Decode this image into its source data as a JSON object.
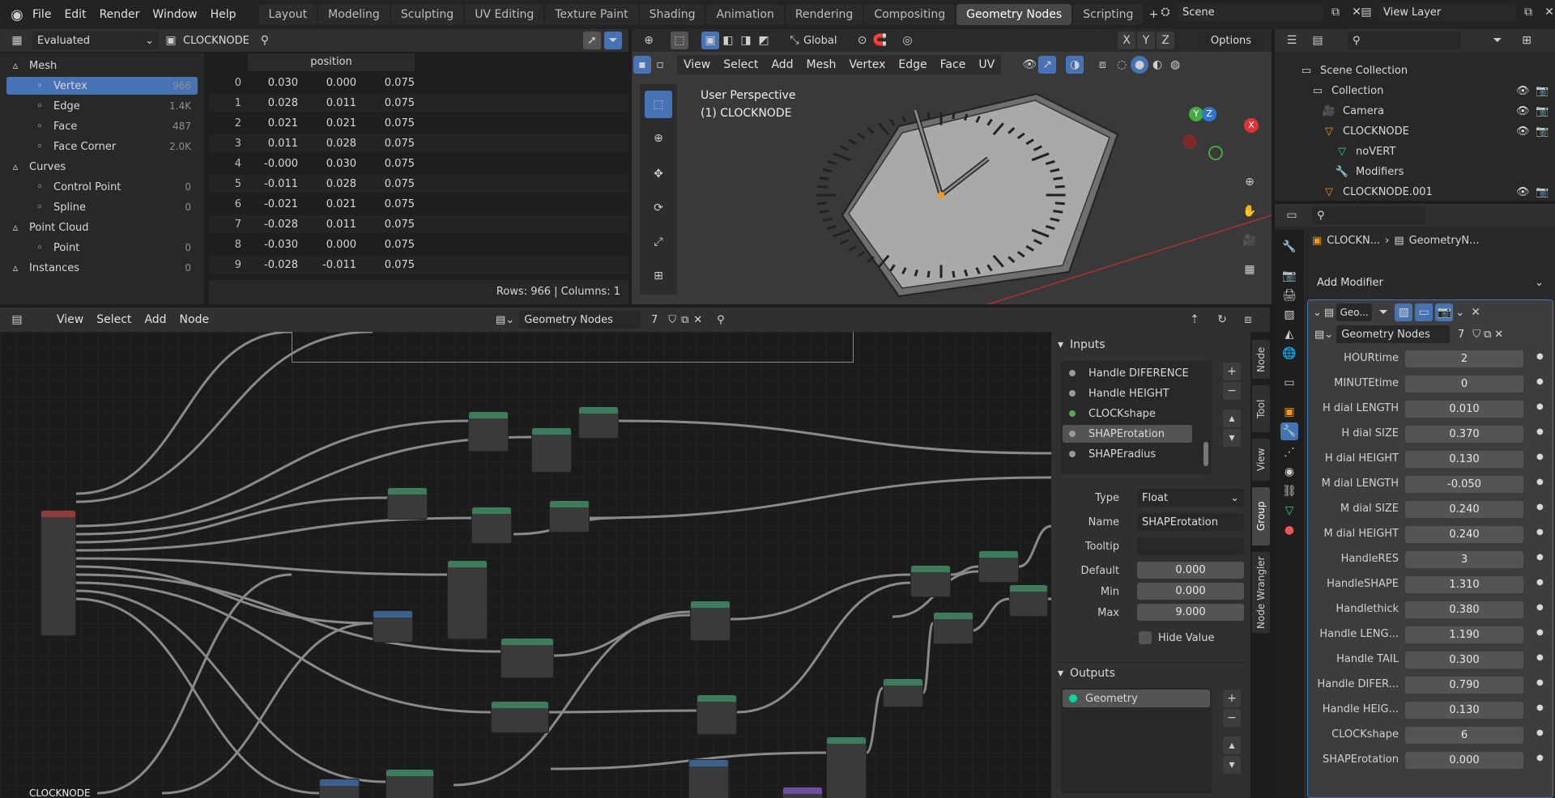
{
  "menu": {
    "file": "File",
    "edit": "Edit",
    "render": "Render",
    "window": "Window",
    "help": "Help"
  },
  "workspaces": [
    "Layout",
    "Modeling",
    "Sculpting",
    "UV Editing",
    "Texture Paint",
    "Shading",
    "Animation",
    "Rendering",
    "Compositing",
    "Geometry Nodes",
    "Scripting"
  ],
  "active_workspace": "Geometry Nodes",
  "scene": "Scene",
  "view_layer": "View Layer",
  "spreadsheet": {
    "mode": "Evaluated",
    "object": "CLOCKNODE",
    "column_header": "position",
    "tree": [
      {
        "label": "Mesh",
        "count": "",
        "type": "header"
      },
      {
        "label": "Vertex",
        "count": "966",
        "type": "item",
        "active": true
      },
      {
        "label": "Edge",
        "count": "1.4K",
        "type": "item"
      },
      {
        "label": "Face",
        "count": "487",
        "type": "item"
      },
      {
        "label": "Face Corner",
        "count": "2.0K",
        "type": "item"
      },
      {
        "label": "Curves",
        "count": "",
        "type": "header"
      },
      {
        "label": "Control Point",
        "count": "0",
        "type": "item"
      },
      {
        "label": "Spline",
        "count": "0",
        "type": "item"
      },
      {
        "label": "Point Cloud",
        "count": "",
        "type": "header"
      },
      {
        "label": "Point",
        "count": "0",
        "type": "item"
      },
      {
        "label": "Instances",
        "count": "0",
        "type": "header"
      }
    ],
    "rows": [
      [
        "0",
        "0.030",
        "0.000",
        "0.075"
      ],
      [
        "1",
        "0.028",
        "0.011",
        "0.075"
      ],
      [
        "2",
        "0.021",
        "0.021",
        "0.075"
      ],
      [
        "3",
        "0.011",
        "0.028",
        "0.075"
      ],
      [
        "4",
        "-0.000",
        "0.030",
        "0.075"
      ],
      [
        "5",
        "-0.011",
        "0.028",
        "0.075"
      ],
      [
        "6",
        "-0.021",
        "0.021",
        "0.075"
      ],
      [
        "7",
        "-0.028",
        "0.011",
        "0.075"
      ],
      [
        "8",
        "-0.030",
        "0.000",
        "0.075"
      ],
      [
        "9",
        "-0.028",
        "-0.011",
        "0.075"
      ]
    ],
    "footer": "Rows: 966   |   Columns: 1"
  },
  "viewport": {
    "orientation": "Global",
    "options": "Options",
    "menu": [
      "View",
      "Select",
      "Add",
      "Mesh",
      "Vertex",
      "Edge",
      "Face",
      "UV"
    ],
    "title": "User Perspective",
    "subtitle": "(1) CLOCKNODE",
    "axes": [
      "X",
      "Y",
      "Z"
    ]
  },
  "outliner": {
    "items": [
      {
        "label": "Scene Collection"
      },
      {
        "label": "Collection"
      },
      {
        "label": "Camera"
      },
      {
        "label": "CLOCKNODE"
      },
      {
        "label": "noVERT"
      },
      {
        "label": "Modifiers"
      },
      {
        "label": "CLOCKNODE.001"
      }
    ]
  },
  "properties": {
    "breadcrumb_object": "CLOCKN...",
    "breadcrumb_modifier": "GeometryN...",
    "add_modifier": "Add Modifier",
    "modifier_name": "Geo...",
    "node_group": "Geometry Nodes",
    "users": "7",
    "params": [
      {
        "label": "HOURtime",
        "value": "2"
      },
      {
        "label": "MINUTEtime",
        "value": "0"
      },
      {
        "label": "H dial LENGTH",
        "value": "0.010"
      },
      {
        "label": "H dial SIZE",
        "value": "0.370"
      },
      {
        "label": "H dial HEIGHT",
        "value": "0.130"
      },
      {
        "label": "M dial LENGTH",
        "value": "-0.050"
      },
      {
        "label": "M dial SIZE",
        "value": "0.240"
      },
      {
        "label": "M dial HEIGHT",
        "value": "0.240"
      },
      {
        "label": "HandleRES",
        "value": "3"
      },
      {
        "label": "HandleSHAPE",
        "value": "1.310"
      },
      {
        "label": "Handlethick",
        "value": "0.380"
      },
      {
        "label": "Handle LENG...",
        "value": "1.190"
      },
      {
        "label": "Handle TAIL",
        "value": "0.300"
      },
      {
        "label": "Handle DIFER...",
        "value": "0.790"
      },
      {
        "label": "Handle HEIG...",
        "value": "0.130"
      },
      {
        "label": "CLOCKshape",
        "value": "6"
      },
      {
        "label": "SHAPErotation",
        "value": "0.000"
      }
    ]
  },
  "node_editor": {
    "menu": [
      "View",
      "Select",
      "Add",
      "Node"
    ],
    "tree_name": "Geometry Nodes",
    "users": "7",
    "footer_label": "CLOCKNODE"
  },
  "group_panel": {
    "inputs_title": "Inputs",
    "inputs": [
      "Handle DIFERENCE",
      "Handle HEIGHT",
      "CLOCKshape",
      "SHAPErotation",
      "SHAPEradius"
    ],
    "active_input": "SHAPErotation",
    "type_label": "Type",
    "type_value": "Float",
    "name_label": "Name",
    "name_value": "SHAPErotation",
    "tooltip_label": "Tooltip",
    "tooltip_value": "",
    "default_label": "Default",
    "default_value": "0.000",
    "min_label": "Min",
    "min_value": "0.000",
    "max_label": "Max",
    "max_value": "9.000",
    "hide_value": "Hide Value",
    "outputs_title": "Outputs",
    "outputs": [
      "Geometry"
    ],
    "side_tabs": [
      "Node",
      "Tool",
      "View",
      "Group",
      "Node Wrangler"
    ]
  },
  "colors": {
    "accent": "#4772b3",
    "node_geometry": "#00d6a3",
    "node_input": "#8f3b3b",
    "node_vector": "#3b5f8f",
    "node_group": "#3b7d5a"
  }
}
